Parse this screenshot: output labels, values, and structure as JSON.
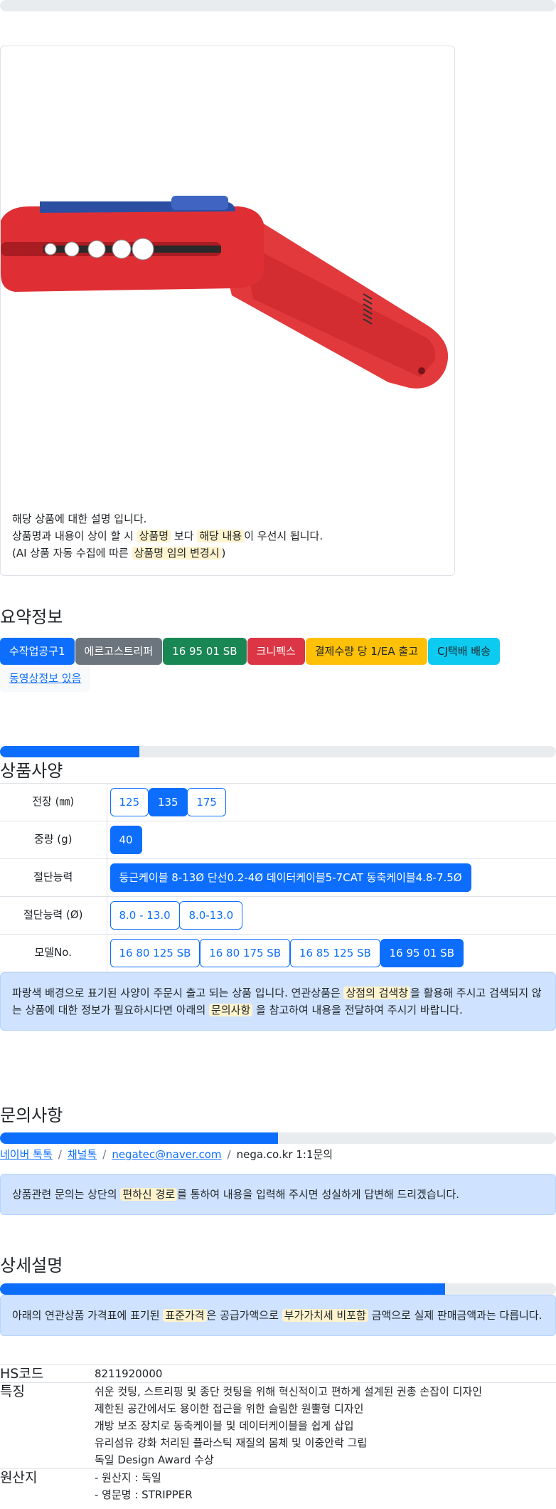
{
  "top_progress_pct": 0,
  "product": {
    "image_alt": "Knipex ErgoStrip universal stripping tool (red/blue)",
    "notes": {
      "line1": "해당 상품에 대한 설명 입니다.",
      "line2_a": "상품명과 내용이 상이 할 시",
      "line2_hl1": "상품명",
      "line2_b": "보다",
      "line2_hl2": "해당 내용",
      "line2_c": "이 우선시 됩니다.",
      "line3_a": "(AI 상품 자동 수집에 따른",
      "line3_hl": "상품명 임의 변경시",
      "line3_b": ")"
    }
  },
  "summary": {
    "title": "요약정보",
    "badges": [
      {
        "label": "수작업공구1",
        "color": "#0d6efd"
      },
      {
        "label": "에르고스트리퍼",
        "color": "#6c757d"
      },
      {
        "label": "16 95 01 SB",
        "color": "#198754"
      },
      {
        "label": "크니펙스",
        "color": "#dc3545"
      },
      {
        "label": "결제수량 당 1/EA 출고",
        "color": "#ffc107"
      },
      {
        "label": "CJ택배 배송",
        "color": "#0dcaf0"
      },
      {
        "label": "동영상정보 있음",
        "color": "#f8f9fa"
      }
    ]
  },
  "specs": {
    "progress_pct": 25,
    "title": "상품사양",
    "rows": [
      {
        "label": "전장 (㎜)",
        "options": [
          {
            "v": "125",
            "on": false
          },
          {
            "v": "135",
            "on": true
          },
          {
            "v": "175",
            "on": false
          }
        ]
      },
      {
        "label": "중량 (g)",
        "options": [
          {
            "v": "40",
            "on": true
          }
        ]
      },
      {
        "label": "절단능력",
        "options": [
          {
            "v": "둥근케이블 8-13Ø 단선0.2-4Ø 데이터케이블5-7CAT 동축케이블4.8-7.5Ø",
            "on": true
          }
        ]
      },
      {
        "label": "절단능력 (Ø)",
        "options": [
          {
            "v": "8.0 - 13.0",
            "on": false
          },
          {
            "v": "8.0-13.0",
            "on": false
          }
        ]
      },
      {
        "label": "모델No.",
        "options": [
          {
            "v": "16 80 125 SB",
            "on": false
          },
          {
            "v": "16 80 175 SB",
            "on": false
          },
          {
            "v": "16 85 125 SB",
            "on": false
          },
          {
            "v": "16 95 01 SB",
            "on": true
          }
        ]
      }
    ],
    "alert": {
      "a": "파랑색 배경으로 표기된 사양이 주문시 출고 되는 상품 입니다. 연관상품은",
      "hl1": "상점의 검색창",
      "b": "을 활용해 주시고 검색되지 않는 상품에 대한 정보가 필요하시다면 아래의",
      "hl2": "문의사항",
      "c": "을 참고하여 내용을 전달하여 주시기 바랍니다."
    }
  },
  "inquiry": {
    "title": "문의사항",
    "progress_pct": 50,
    "links": [
      "네이버 톡톡",
      "채널톡",
      "negatec@naver.com"
    ],
    "last_crumb": "nega.co.kr 1:1문의",
    "alert": {
      "a": "상품관련 문의는 상단의",
      "hl": "편하신 경로",
      "b": "를 통하여 내용을 입력해 주시면 성실하게 답변해 드리겠습니다."
    }
  },
  "detail": {
    "title": "상세설명",
    "progress_pct": 80,
    "alert": {
      "a": "아래의 연관상품 가격표에 표기된",
      "hl1": "표준가격",
      "b": "은 공급가액으로",
      "hl2": "부가가치세 비포함",
      "c": "금액으로 실제 판매금액과는 다릅니다."
    },
    "info": {
      "hs_label": "HS코드",
      "hs_value": "8211920000",
      "feat_label": "특징",
      "features": [
        "쉬운 컷팅, 스트리핑 및 종단 컷팅을 위해 혁신적이고 편하게 설계된 권총 손잡이 디자인",
        "제한된 공간에서도 용이한 접근을 위한 슬림한 원뿔형 디자인",
        "개방 보조 장치로 동축케이블 및 데이터케이블을 쉽게 삽입",
        "유리섬유 강화 처리된 플라스틱 재질의 몸체 및 이중안락 그립",
        "독일 Design Award 수상"
      ],
      "origin_label": "원산지",
      "origin_lines": [
        "- 원산지 : 독일",
        "- 영문명 : STRIPPER"
      ]
    }
  }
}
